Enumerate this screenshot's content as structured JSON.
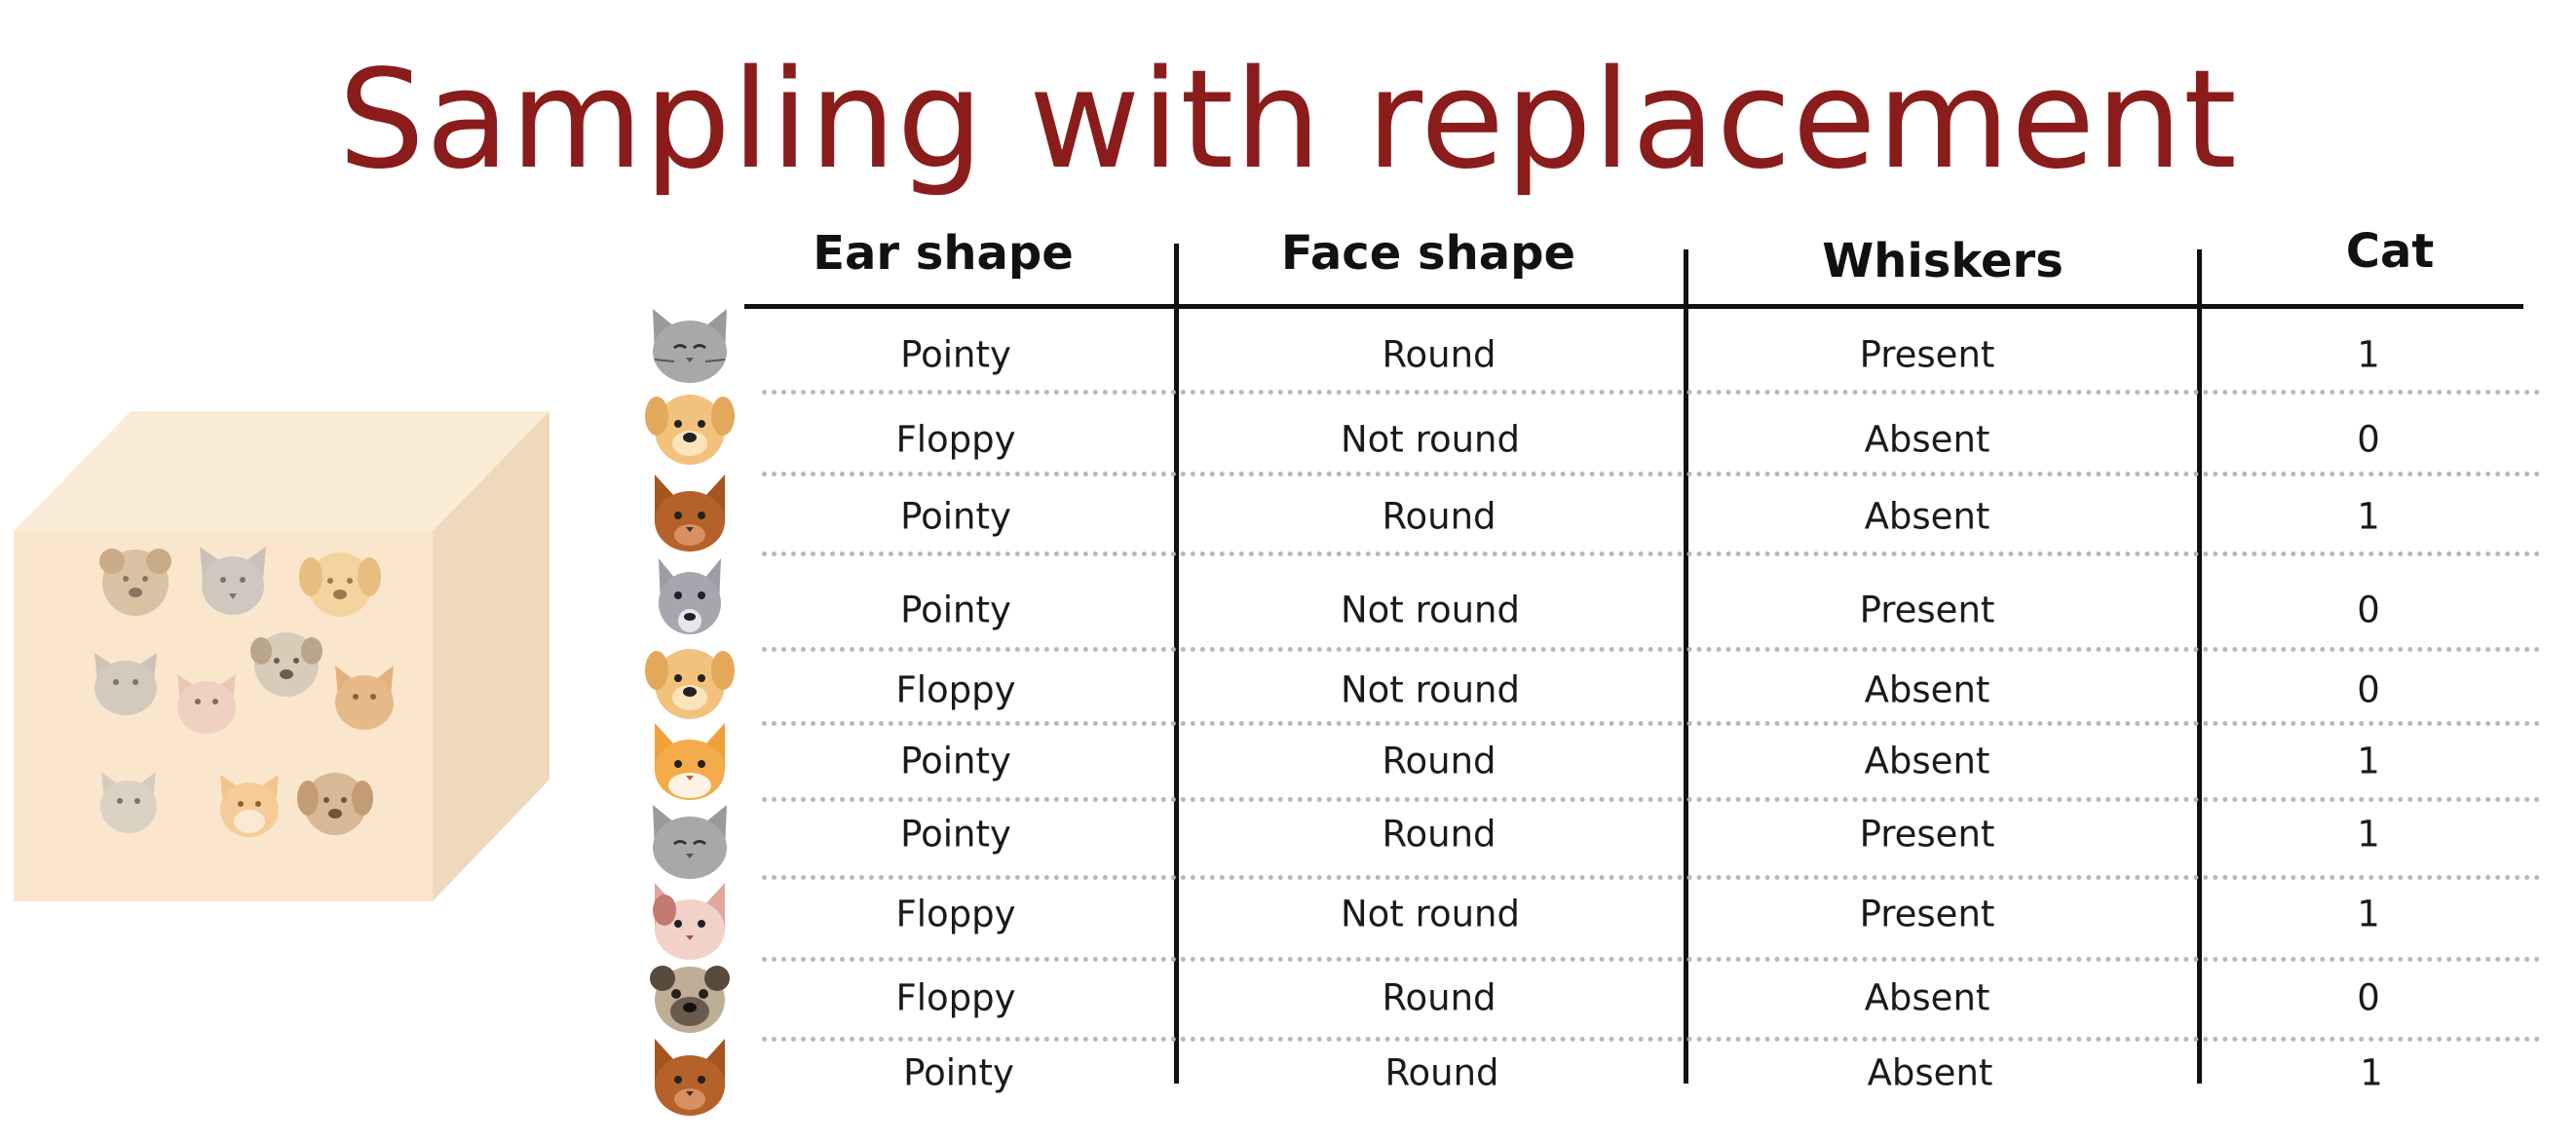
{
  "slide": {
    "title": "Sampling with replacement"
  },
  "table": {
    "headers": [
      "Ear shape",
      "Face shape",
      "Whiskers",
      "Cat"
    ],
    "rows": [
      {
        "animal": "gray-cat-icon",
        "ear": "Pointy",
        "face": "Round",
        "whiskers": "Present",
        "cat": "1"
      },
      {
        "animal": "tan-dog-icon",
        "ear": "Floppy",
        "face": "Not round",
        "whiskers": "Absent",
        "cat": "0"
      },
      {
        "animal": "brown-cat-icon",
        "ear": "Pointy",
        "face": "Round",
        "whiskers": "Absent",
        "cat": "1"
      },
      {
        "animal": "gray-dog-icon",
        "ear": "Pointy",
        "face": "Not round",
        "whiskers": "Present",
        "cat": "0"
      },
      {
        "animal": "tan-dog-icon",
        "ear": "Floppy",
        "face": "Not round",
        "whiskers": "Absent",
        "cat": "0"
      },
      {
        "animal": "orange-cat-icon",
        "ear": "Pointy",
        "face": "Round",
        "whiskers": "Absent",
        "cat": "1"
      },
      {
        "animal": "gray-cat-icon",
        "ear": "Pointy",
        "face": "Round",
        "whiskers": "Present",
        "cat": "1"
      },
      {
        "animal": "pink-cat-icon",
        "ear": "Floppy",
        "face": "Not round",
        "whiskers": "Present",
        "cat": "1"
      },
      {
        "animal": "pug-dog-icon",
        "ear": "Floppy",
        "face": "Round",
        "whiskers": "Absent",
        "cat": "0"
      },
      {
        "animal": "brown-cat-icon",
        "ear": "Pointy",
        "face": "Round",
        "whiskers": "Absent",
        "cat": "1"
      }
    ]
  },
  "colors": {
    "title": "#8b1c1c",
    "cube_front": "#fae6cc",
    "cube_top": "#fbecd8",
    "cube_side": "#efd8bc",
    "rule": "#111111",
    "dotted": "#b8b8b8"
  }
}
